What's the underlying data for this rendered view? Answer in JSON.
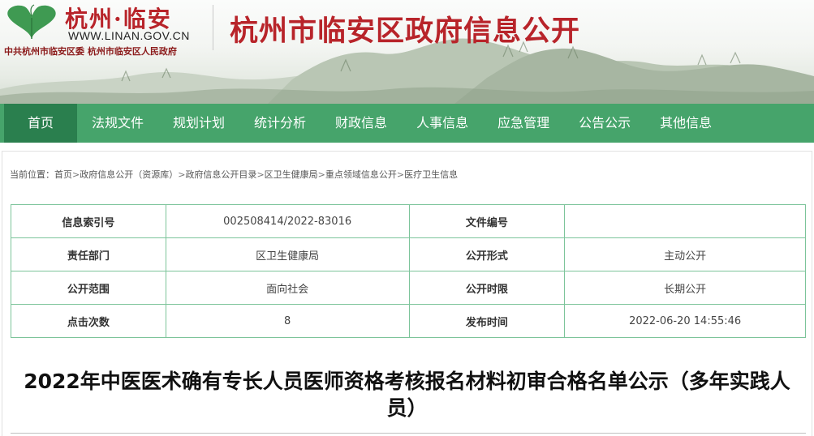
{
  "header": {
    "logo_text": "杭州·临安",
    "logo_url": "WWW.LINAN.GOV.CN",
    "org_text": "中共杭州市临安区委  杭州市临安区人民政府",
    "site_title": "杭州市临安区政府信息公开",
    "colors": {
      "brand_red": "#b8242a",
      "nav_green": "#46a46b",
      "nav_active": "#2a7f4e",
      "table_border": "#7cc49a"
    }
  },
  "nav": {
    "items": [
      {
        "label": "首页",
        "active": true
      },
      {
        "label": "法规文件"
      },
      {
        "label": "规划计划"
      },
      {
        "label": "统计分析"
      },
      {
        "label": "财政信息"
      },
      {
        "label": "人事信息"
      },
      {
        "label": "应急管理"
      },
      {
        "label": "公告公示"
      },
      {
        "label": "其他信息"
      }
    ]
  },
  "breadcrumb": {
    "prefix": "当前位置：",
    "items": [
      "首页",
      "政府信息公开（资源库）",
      "政府信息公开目录",
      "区卫生健康局",
      "重点领域信息公开",
      "医疗卫生信息"
    ],
    "separator": ">"
  },
  "info": {
    "rows": [
      {
        "k1": "信息索引号",
        "v1": "002508414/2022-83016",
        "k2": "文件编号",
        "v2": ""
      },
      {
        "k1": "责任部门",
        "v1": "区卫生健康局",
        "k2": "公开形式",
        "v2": "主动公开"
      },
      {
        "k1": "公开范围",
        "v1": "面向社会",
        "k2": "公开时限",
        "v2": "长期公开"
      },
      {
        "k1": "点击次数",
        "v1": "8",
        "k2": "发布时间",
        "v2": "2022-06-20 14:55:46"
      }
    ]
  },
  "document": {
    "title": "2022年中医医术确有专长人员医师资格考核报名材料初审合格名单公示（多年实践人员）"
  }
}
